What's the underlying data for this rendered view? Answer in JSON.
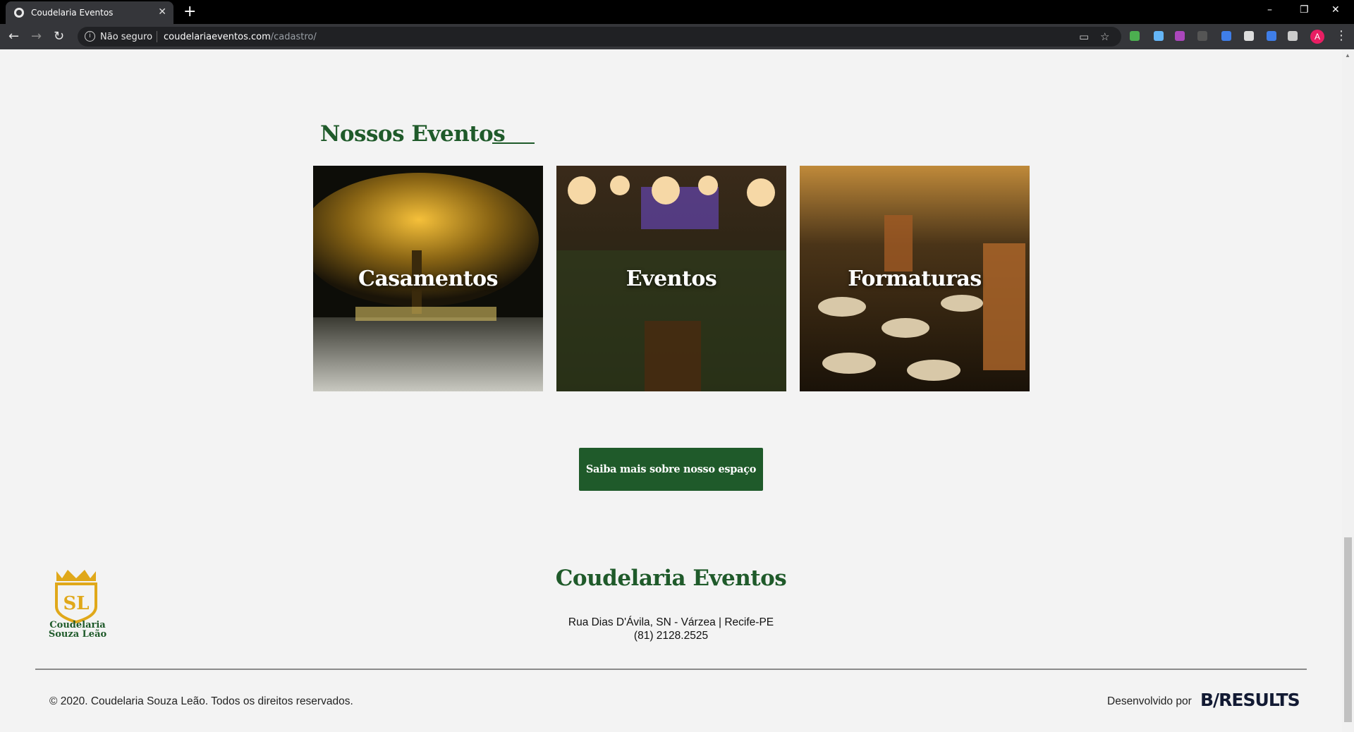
{
  "browser": {
    "tab_title": "Coudelaria Eventos",
    "tab_close": "✕",
    "new_tab": "+",
    "window_controls": [
      "–",
      "❐",
      "✕"
    ],
    "security_label": "Não seguro",
    "url_host": "coudelariaeventos.com",
    "url_path": "/cadastro/",
    "avatar_letter": "A"
  },
  "section": {
    "title": "Nossos Eventos"
  },
  "cards": [
    {
      "label": "Casamentos",
      "image": "wedding-night-crowd"
    },
    {
      "label": "Eventos",
      "image": "hall-with-lanterns"
    },
    {
      "label": "Formaturas",
      "image": "gala-dining-hall"
    }
  ],
  "cta": {
    "label": "Saiba mais sobre nosso espaço"
  },
  "logo": {
    "monogram": "SL",
    "name_line1": "Coudelaria",
    "name_line2": "Souza Leão"
  },
  "footer": {
    "title": "Coudelaria Eventos",
    "address": "Rua Dias D'Ávila, SN - Várzea | Recife-PE",
    "phone": "(81) 2128.2525",
    "copyright": "© 2020. Coudelaria Souza Leão. Todos os direitos reservados.",
    "developed_by": "Desenvolvido por",
    "developer_brand": "B/RESULTS"
  },
  "colors": {
    "brand_green": "#1f5a2a",
    "logo_gold": "#e0a81a",
    "page_bg": "#f3f3f3"
  }
}
